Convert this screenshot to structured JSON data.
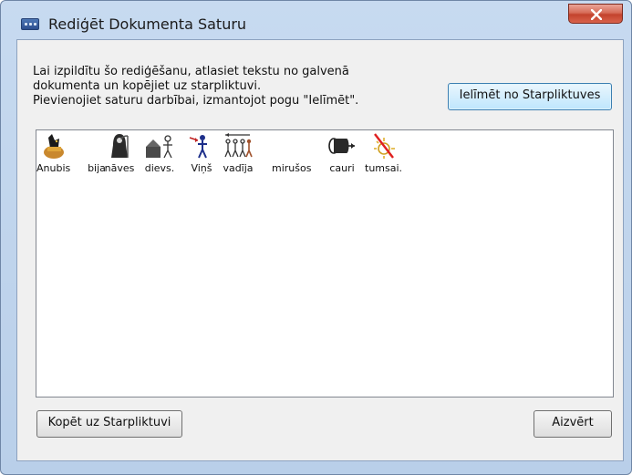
{
  "window": {
    "title": "Rediģēt Dokumenta Saturu",
    "close_symbol": "×"
  },
  "instructions": [
    "Lai izpildītu šo rediģēšanu, atlasiet tekstu no galvenā",
    "dokumenta un kopējiet uz starpliktuvi.",
    "Pievienojiet saturu darbībai, izmantojot pogu \"Ielīmēt\"."
  ],
  "buttons": {
    "paste_label": "Ielīmēt no Starpliktuves",
    "copy_label": "Kopēt uz Starpliktuvi",
    "close_label": "Aizvērt"
  },
  "symbols": [
    {
      "word": "Anubis",
      "icon": "anubis-icon"
    },
    {
      "word": "bija",
      "icon": "blank"
    },
    {
      "word": "nāves",
      "icon": "death-icon"
    },
    {
      "word": "dievs.",
      "icon": "god-icon"
    },
    {
      "word": "Viņš",
      "icon": "he-icon"
    },
    {
      "word": "vadīja",
      "icon": "lead-icon"
    },
    {
      "word": "mirušos",
      "icon": "blank"
    },
    {
      "word": "cauri",
      "icon": "through-icon"
    },
    {
      "word": "tumsai.",
      "icon": "darkness-icon"
    }
  ]
}
